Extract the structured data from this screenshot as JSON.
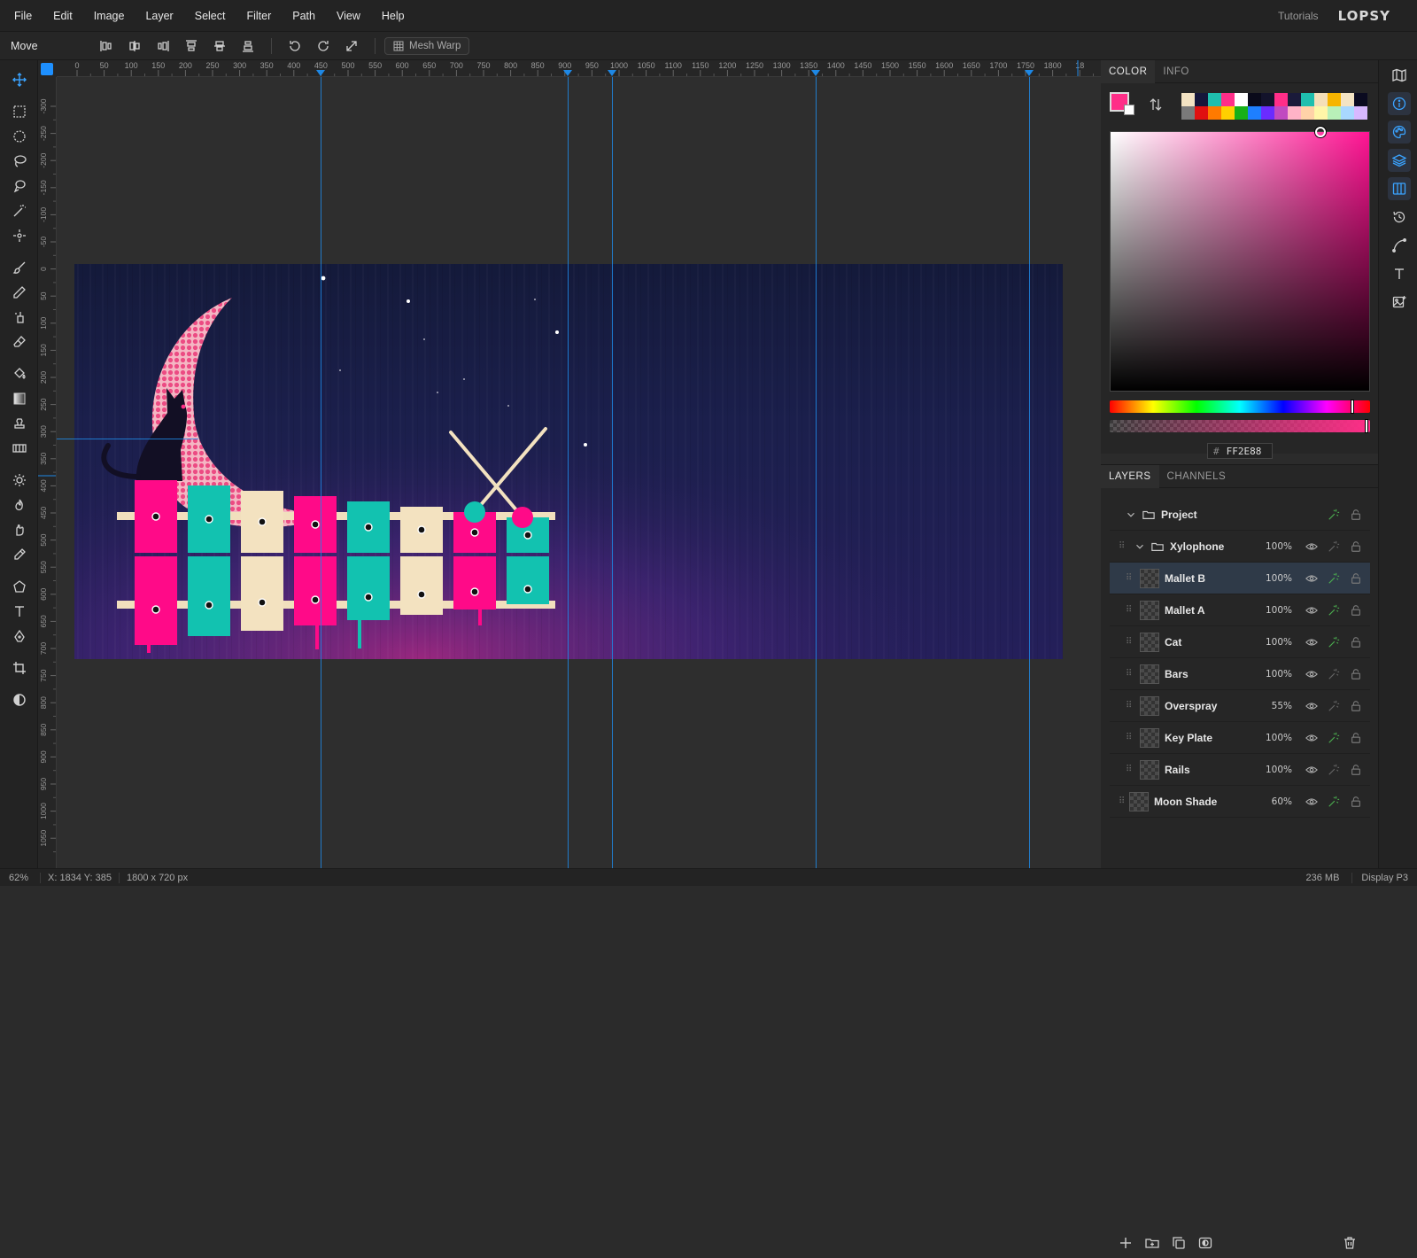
{
  "menu": [
    "File",
    "Edit",
    "Image",
    "Layer",
    "Select",
    "Filter",
    "Path",
    "View",
    "Help"
  ],
  "header": {
    "tutorials": "Tutorials",
    "logo": "LOPSY"
  },
  "options": {
    "tool_name": "Move",
    "mesh_warp": "Mesh Warp"
  },
  "ruler": {
    "h_labels": [
      "0",
      "50",
      "100",
      "150",
      "200",
      "250",
      "300",
      "350",
      "400",
      "450",
      "500",
      "550",
      "600",
      "650",
      "700",
      "750",
      "800",
      "850",
      "900",
      "950",
      "1000",
      "1050",
      "1100",
      "1150",
      "1200",
      "1250",
      "1300",
      "1350",
      "1400",
      "1450",
      "1500",
      "1550",
      "1600",
      "1650",
      "1700",
      "1750",
      "1800",
      "18"
    ],
    "v_labels": [
      "-300",
      "-250",
      "-200",
      "-150",
      "-100",
      "-50",
      "0",
      "50",
      "100",
      "150",
      "200",
      "250",
      "300",
      "350",
      "400",
      "450",
      "500",
      "550",
      "600",
      "650",
      "700",
      "750",
      "800",
      "850",
      "900",
      "950",
      "1000",
      "1050"
    ]
  },
  "color_panel": {
    "tabs": [
      "COLOR",
      "INFO"
    ],
    "foreground": "#FF2E88",
    "background": "#FFFFFF",
    "hex": "FF2E88",
    "swatches": [
      "#f3e3c3",
      "#15163a",
      "#1fbfae",
      "#ff2e88",
      "#ffffff",
      "#0a0a1a",
      "#13132b",
      "#ff2e88",
      "#1a1a3a",
      "#1fbfae",
      "#f5dfb8",
      "#f6b400",
      "#f3e3c3",
      "#0b0b20",
      "#7a7a7a",
      "#e01010",
      "#ff7a00",
      "#ffd000",
      "#18b018",
      "#1e7fff",
      "#6a2cff",
      "#c04ac0",
      "#ffb3c7",
      "#ffd2a8",
      "#fff6a8",
      "#b8f0b8",
      "#a8d8ff",
      "#d8b8ff"
    ]
  },
  "layers_panel": {
    "tabs": [
      "LAYERS",
      "CHANNELS"
    ],
    "rows": [
      {
        "name": "Project",
        "opacity": "",
        "type": "group",
        "indent": 0
      },
      {
        "name": "Xylophone",
        "opacity": "100%",
        "type": "group",
        "indent": 1
      },
      {
        "name": "Mallet B",
        "opacity": "100%",
        "type": "layer",
        "indent": 2,
        "selected": true
      },
      {
        "name": "Mallet A",
        "opacity": "100%",
        "type": "layer",
        "indent": 2
      },
      {
        "name": "Cat",
        "opacity": "100%",
        "type": "layer",
        "indent": 2
      },
      {
        "name": "Bars",
        "opacity": "100%",
        "type": "layer",
        "indent": 2
      },
      {
        "name": "Overspray",
        "opacity": "55%",
        "type": "layer",
        "indent": 2
      },
      {
        "name": "Key Plate",
        "opacity": "100%",
        "type": "layer",
        "indent": 2
      },
      {
        "name": "Rails",
        "opacity": "100%",
        "type": "layer",
        "indent": 2
      },
      {
        "name": "Moon Shade",
        "opacity": "60%",
        "type": "layer",
        "indent": 1
      }
    ]
  },
  "status": {
    "zoom": "62%",
    "coords": "X: 1834  Y: 385",
    "dims": "1800 x 720 px",
    "memory": "236 MB",
    "profile": "Display P3"
  },
  "icons": {
    "tools": [
      "move-icon",
      "rect-select-icon",
      "ellipse-select-icon",
      "lasso-icon",
      "magnetic-lasso-icon",
      "magic-wand-icon",
      "quick-select-icon",
      "brush-icon",
      "pencil-icon",
      "clone-icon",
      "eraser-icon",
      "bucket-icon",
      "gradient-icon",
      "stamp-icon",
      "filmstrip-icon",
      "dodge-icon",
      "burn-icon",
      "smudge-icon",
      "eyedropper-icon",
      "shape-icon",
      "type-icon",
      "pen-icon",
      "crop-icon",
      "contrast-icon"
    ],
    "right": [
      "map-icon",
      "info-icon",
      "palette-icon",
      "layers-icon",
      "columns-icon",
      "history-icon",
      "curve-icon",
      "text-icon",
      "image-icon"
    ]
  }
}
